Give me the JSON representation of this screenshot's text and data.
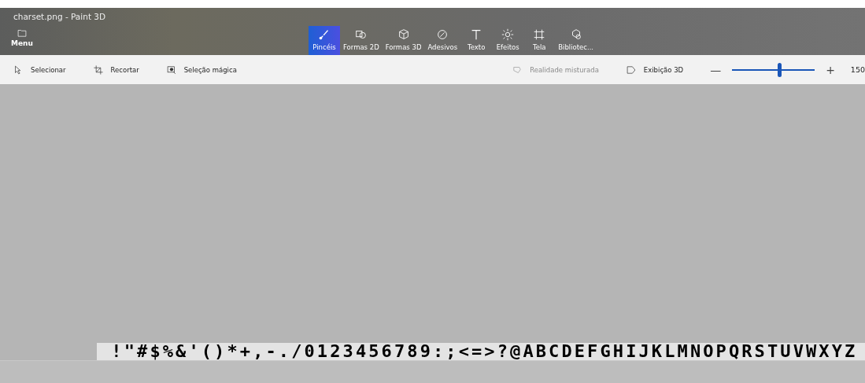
{
  "window": {
    "title": "charset.png - Paint 3D"
  },
  "menu_button": {
    "label": "Menu"
  },
  "tabs": [
    {
      "label": "Pincéis",
      "selected": true
    },
    {
      "label": "Formas 2D",
      "selected": false
    },
    {
      "label": "Formas 3D",
      "selected": false
    },
    {
      "label": "Adesivos",
      "selected": false
    },
    {
      "label": "Texto",
      "selected": false
    },
    {
      "label": "Efeitos",
      "selected": false
    },
    {
      "label": "Tela",
      "selected": false
    },
    {
      "label": "Bibliotec...",
      "selected": false
    }
  ],
  "toolbar": [
    {
      "label": "Selecionar"
    },
    {
      "label": "Recortar"
    },
    {
      "label": "Seleção mágica"
    }
  ],
  "right_tools": [
    {
      "label": "Realidade misturada",
      "disabled": true
    },
    {
      "label": "Exibição 3D",
      "disabled": false
    }
  ],
  "zoom": {
    "minus": "—",
    "plus": "+",
    "level": 0.57,
    "reading": "150"
  },
  "canvas": {
    "charset": " !\"#$%&'()*+,-./0123456789:;<=>?@ABCDEFGHIJKLMNOPQRSTUVWXYZ"
  }
}
